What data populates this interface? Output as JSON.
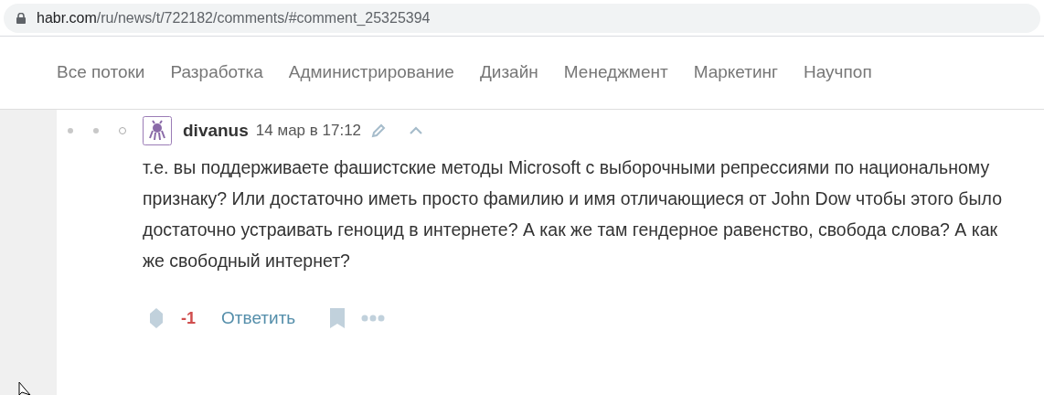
{
  "address_bar": {
    "domain": "habr.com",
    "path": "/ru/news/t/722182/comments/#comment_25325394"
  },
  "nav": [
    "Все потоки",
    "Разработка",
    "Администрирование",
    "Дизайн",
    "Менеджмент",
    "Маркетинг",
    "Научпоп"
  ],
  "thread_markers": [
    {
      "filled": true
    },
    {
      "filled": true
    },
    {
      "filled": false
    }
  ],
  "comment": {
    "author": "divanus",
    "time": "14 мар в 17:12",
    "text": "т.е. вы поддерживаете фашистские методы Microsoft с выборочными репрессиями по национальному признаку? Или достаточно иметь просто фамилию и имя отличающиеся от John Dow чтобы этого было достаточно устраивать геноцид в интернете? А как же там гендерное равенство, свобода слова? А как же свободный интернет?",
    "score": "-1",
    "reply": "Ответить"
  }
}
